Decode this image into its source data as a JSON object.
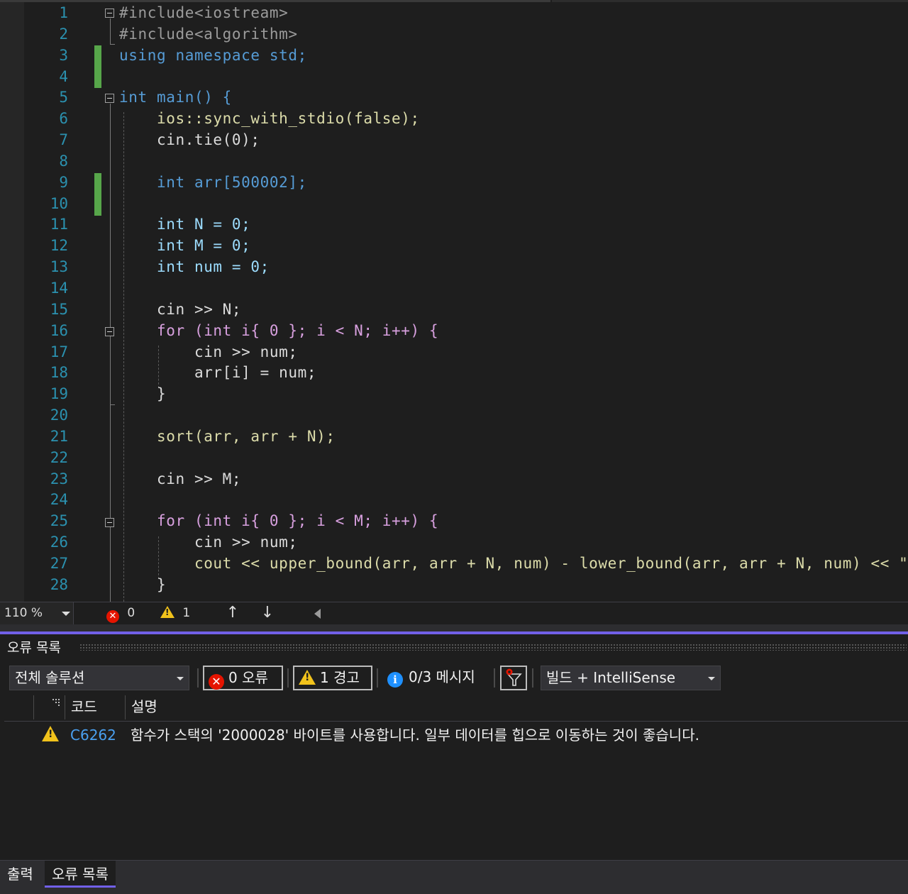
{
  "editor": {
    "line_numbers": [
      "1",
      "2",
      "3",
      "4",
      "5",
      "6",
      "7",
      "8",
      "9",
      "10",
      "11",
      "12",
      "13",
      "14",
      "15",
      "16",
      "17",
      "18",
      "19",
      "20",
      "21",
      "22",
      "23",
      "24",
      "25",
      "26",
      "27",
      "28"
    ],
    "code_lines": [
      "#include<iostream>",
      "#include<algorithm>",
      "using namespace std;",
      "",
      "int main() {",
      "    ios::sync_with_stdio(false);",
      "    cin.tie(0);",
      "",
      "    int arr[500002];",
      "",
      "    int N = 0;",
      "    int M = 0;",
      "    int num = 0;",
      "",
      "    cin >> N;",
      "    for (int i{ 0 }; i < N; i++) {",
      "        cin >> num;",
      "        arr[i] = num;",
      "    }",
      "",
      "    sort(arr, arr + N);",
      "",
      "    cin >> M;",
      "",
      "    for (int i{ 0 }; i < M; i++) {",
      "        cin >> num;",
      "        cout << upper_bound(arr, arr + N, num) - lower_bound(arr, arr + N, num) << \" \";",
      "    }"
    ],
    "colors": {
      "keyword": "#569cd6",
      "control": "#d8a0df",
      "string": "#d69d85",
      "function": "#dcdcaa",
      "variable": "#9cdcfe",
      "namespace": "#4ec9b0",
      "line_number": "#2b91af",
      "change_bar": "#57a64a"
    }
  },
  "status_bar": {
    "zoom": "110 %",
    "error_count": "0",
    "warning_count": "1"
  },
  "error_list": {
    "title": "오류 목록",
    "scope": "전체 솔루션",
    "errors_toggle": "0 오류",
    "warnings_toggle": "1 경고",
    "messages_toggle": "0/3 메시지",
    "source": "빌드 + IntelliSense",
    "columns": {
      "code": "코드",
      "description": "설명"
    },
    "rows": [
      {
        "severity": "warning",
        "code": "C6262",
        "description": "함수가 스택의 '2000028' 바이트를 사용합니다.  일부 데이터를 힙으로 이동하는 것이 좋습니다."
      }
    ],
    "accent_color": "#7160e8"
  },
  "bottom_tabs": [
    {
      "label": "출력",
      "active": false
    },
    {
      "label": "오류 목록",
      "active": true
    }
  ]
}
